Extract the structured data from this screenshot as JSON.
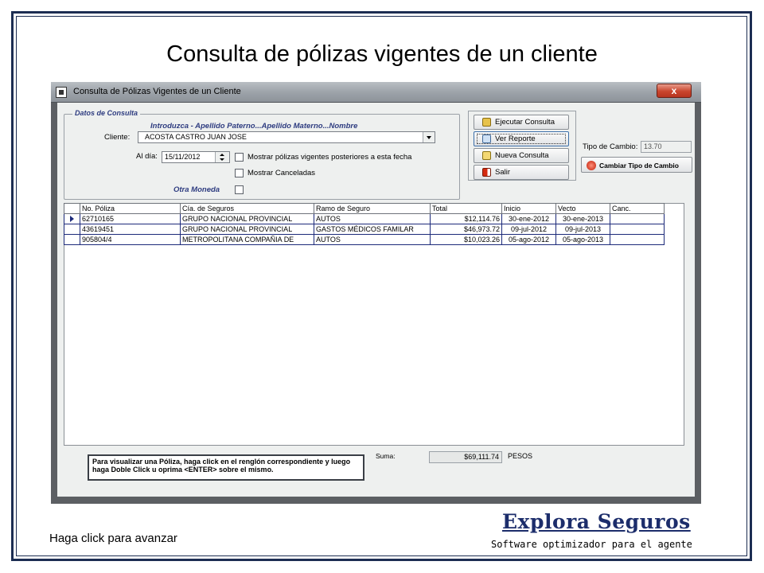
{
  "slide": {
    "title": "Consulta de pólizas vigentes de un cliente",
    "advance_hint": "Haga click para avanzar",
    "brand": "Explora Seguros",
    "tagline": "Software optimizador para el agente",
    "frame_color": "#1c2d52"
  },
  "window": {
    "title": "Consulta de Pólizas Vigentes de un Cliente",
    "close_label": "x"
  },
  "query": {
    "legend": "Datos de Consulta",
    "hint": "Introduzca - Apellido Paterno...Apellido Materno...Nombre",
    "client_label": "Cliente:",
    "client_value": "ACOSTA CASTRO JUAN JOSE",
    "date_label": "Al día:",
    "date_value": "15/11/2012",
    "chk_later_label": "Mostrar pólizas vigentes posteriores a esta fecha",
    "chk_later_checked": false,
    "chk_canceled_label": "Mostrar Canceladas",
    "chk_canceled_checked": false,
    "other_currency_label": "Otra Moneda",
    "other_currency_checked": false
  },
  "actions": {
    "execute": "Ejecutar Consulta",
    "report": "Ver Reporte",
    "new": "Nueva Consulta",
    "exit": "Salir"
  },
  "exchange": {
    "label": "Tipo de Cambio:",
    "value": "13.70",
    "change_button": "Cambiar Tipo de Cambio"
  },
  "grid": {
    "columns": [
      "No. Póliza",
      "Cía. de Seguros",
      "Ramo de Seguro",
      "Total",
      "Inicio",
      "Vecto",
      "Canc."
    ],
    "rows": [
      {
        "poliza": "62710165",
        "cia": "GRUPO NACIONAL PROVINCIAL",
        "ramo": "AUTOS",
        "total": "$12,114.76",
        "inicio": "30-ene-2012",
        "vecto": "30-ene-2013",
        "canc": "",
        "selected": true
      },
      {
        "poliza": "43619451",
        "cia": "GRUPO NACIONAL PROVINCIAL",
        "ramo": "GASTOS MÉDICOS FAMILAR",
        "total": "$46,973.72",
        "inicio": "09-jul-2012",
        "vecto": "09-jul-2013",
        "canc": "",
        "selected": false
      },
      {
        "poliza": "905804/4",
        "cia": "METROPOLITANA COMPAÑIA DE",
        "ramo": "AUTOS",
        "total": "$10,023.26",
        "inicio": "05-ago-2012",
        "vecto": "05-ago-2013",
        "canc": "",
        "selected": false
      }
    ]
  },
  "footer": {
    "info_text": "Para visualizar una Póliza, haga click en el renglón correspondiente y luego haga Doble Click u oprima <ENTER> sobre el mismo.",
    "sum_label": "Suma:",
    "sum_value": "$69,111.74",
    "currency": "PESOS"
  }
}
